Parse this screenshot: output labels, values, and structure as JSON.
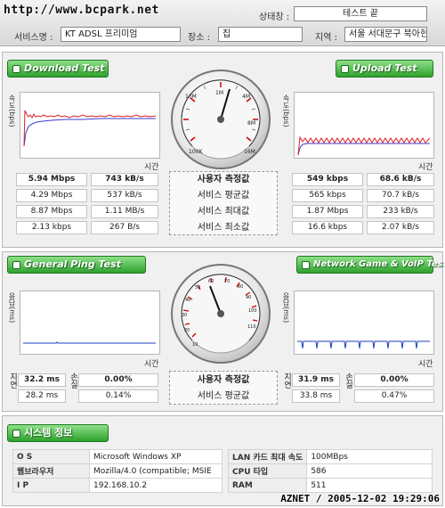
{
  "header": {
    "watermark": "http://www.bcpark.net",
    "status_label": "상태창 :",
    "status_value": "테스트 끝",
    "service_label": "서비스명 :",
    "service_value": "KT ADSL 프리미엄",
    "place_label": "장소 :",
    "place_value": "집",
    "region_label": "지역 :",
    "region_value": "서울 서대문구 북아현"
  },
  "download": {
    "button": "Download Test",
    "ylabel": "속도(bps)",
    "xlabel": "시간",
    "current_mbps": "5.94 Mbps",
    "current_kbs": "743 kB/s",
    "avg_mbps": "4.29 Mbps",
    "avg_kbs": "537 kB/s",
    "max_mbps": "8.87 Mbps",
    "max_kbs": "1.11 MB/s",
    "min_mbps": "2.13 kbps",
    "min_kbs": "267 B/s"
  },
  "upload": {
    "button": "Upload Test",
    "ylabel": "속도(bps)",
    "xlabel": "시간",
    "current_kbps": "549 kbps",
    "current_kbs": "68.6 kB/s",
    "avg_kbps": "565 kbps",
    "avg_kbs": "70.7 kB/s",
    "max_mbps": "1.87 Mbps",
    "max_kbs": "233 kB/s",
    "min_kbps": "16.6 kbps",
    "min_kbs": "2.07 kB/s"
  },
  "speed_center": {
    "user_measured": "사용자 측정값",
    "avg": "서비스 평균값",
    "max": "서비스 최대값",
    "min": "서비스 최소값"
  },
  "speed_gauge": {
    "labels": [
      "100K",
      "10M",
      "1M",
      "4M",
      "8M",
      "16M"
    ],
    "needle_value": "8M"
  },
  "ping": {
    "button": "General Ping Test",
    "ylabel": "응답(ms)",
    "xlabel": "시간",
    "delay_label": "지연",
    "loss_label": "손실",
    "current_delay": "32.2 ms",
    "current_loss": "0.00%",
    "avg_delay": "28.2 ms",
    "avg_loss": "0.14%"
  },
  "game": {
    "button": "Network Game & VoIP Test",
    "ylabel": "응답(ms)",
    "xlabel": "시간",
    "delay_label": "지연",
    "loss_label": "손실",
    "current_delay": "31.9 ms",
    "current_loss": "0.00%",
    "avg_delay": "33.8 ms",
    "avg_loss": "0.47%"
  },
  "ping_center": {
    "user_measured": "사용자 측정값",
    "avg": "서비스 평균값"
  },
  "ping_gauge": {
    "labels": [
      "10",
      "20",
      "30",
      "40",
      "50",
      "60",
      "70",
      "80",
      "90",
      "100",
      "110"
    ]
  },
  "system": {
    "button": "시스템 정보",
    "rows": [
      {
        "k1": "O S",
        "v1": "Microsoft Windows XP",
        "k2": "LAN 카드 최대 속도",
        "v2": "100MBps"
      },
      {
        "k1": "웹브라우저",
        "v1": "Mozilla/4.0 (compatible; MSIE",
        "k2": "CPU 타입",
        "v2": "586"
      },
      {
        "k1": "I P",
        "v1": "192.168.10.2",
        "k2": "RAM",
        "v2": "511"
      }
    ]
  },
  "timestamp": "AZNET / 2005-12-02 19:29:06",
  "colors": {
    "accent_green": "#2ea12d",
    "download_line_red": "#e01f1f",
    "download_line_blue": "#3a3acf",
    "ping_line_blue": "#1d3fb8"
  }
}
